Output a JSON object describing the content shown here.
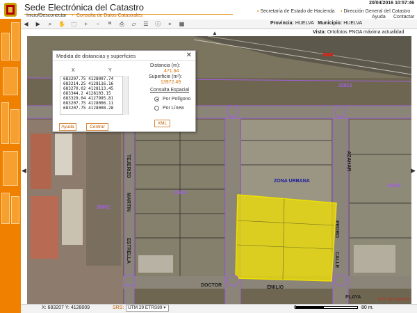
{
  "header": {
    "title": "Sede Electrónica del Catastro",
    "date": "20/04/2016  10:57:46",
    "login": "Inicio/Desconectar",
    "consulta": "Consulta de Datos Catastrales",
    "links": [
      "Secretaría de Estado de Hacienda",
      "Dirección General del Catastro"
    ],
    "ayuda": "Ayuda",
    "contactar": "Contactar"
  },
  "toolbar": {
    "provincia_label": "Provincia:",
    "provincia_value": "HUELVA",
    "municipio_label": "Municipio:",
    "municipio_value": "HUELVA",
    "vista_label": "Vista:",
    "vista_value": "Ortofotos PNOA máxima actualidad"
  },
  "dialog": {
    "title": "Medida de distancias y superficies",
    "close": "✕",
    "col_x": "X",
    "col_y": "Y",
    "coords": [
      "683207.75 4128007.74",
      "683214.25 4128116.16",
      "683270.02 4128113.45",
      "683344.2 4128103.15",
      "683329.04 4127995.81",
      "683207.75 4128006.11",
      "683207.75 4128008.28"
    ],
    "distancia_label": "Distancia (m):",
    "distancia_value": "471.64",
    "superficie_label": "Superficie (m²):",
    "superficie_value": "13972.49",
    "consulta_label": "Consulta Espacial",
    "radio_poligono": "Por Polígono",
    "radio_linea": "Por Línea",
    "btn_ayuda": "Ayuda",
    "btn_centrar": "Centrar",
    "btn_xml": "XML"
  },
  "map": {
    "labels": {
      "zona": "ZONA URBANA",
      "parcel_38001": "38001",
      "parcel_35838": "35838",
      "parcel_32838": "32838",
      "parcel_32815": "32815",
      "street_tejerizo": "TEJERIZO",
      "street_martin": "MARTIN",
      "street_estrella": "ESTRELLA",
      "street_doctor": "DOCTOR",
      "street_emilio": "EMILIO",
      "street_calle": "CALLE",
      "street_azahar": "AZAHAR",
      "street_pedro": "PEDRO",
      "street_playa": "PLAYA",
      "copyright": "D.G. del Catastro"
    }
  },
  "status": {
    "coords": "X: 683207 Y: 4128009",
    "srs_label": "SRS:",
    "srs_value": "UTM 29 ETRS89",
    "scale_left": "0",
    "scale_right": "80 m."
  }
}
